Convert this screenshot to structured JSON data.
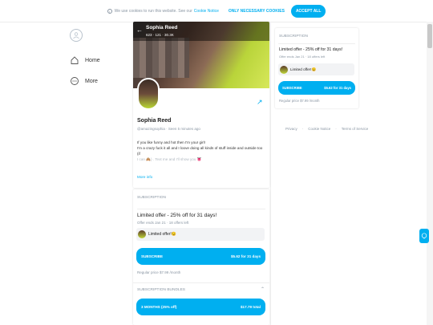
{
  "cookie": {
    "text": "We use cookies to run this website. See our",
    "link": "Cookie Notice",
    "necessary_label": "ONLY NECESSARY COOKIES",
    "accept_label": "ACCEPT ALL"
  },
  "sidebar": {
    "items": [
      {
        "label": "Home",
        "icon": "home-icon"
      },
      {
        "label": "More",
        "icon": "more-icon"
      }
    ]
  },
  "profile": {
    "cover_name": "Sophia Reed",
    "stats": "623 · 121 · 30.3K",
    "name": "Sophia Reed",
    "handle": "@amazingsophia · Seen 5 minutes ago",
    "bio_line1": "If you like funny and hot then I'm your girl!",
    "bio_line2": "I'm a crazy fuck it all and I loove doing all kinds of stuff inside and outside too (if",
    "bio_line3": "I can 🙈) . Text me and I'll show you 👅",
    "more_info": "More info"
  },
  "subscription": {
    "label": "SUBSCRIPTION",
    "offer_title": "Limited offer - 25% off for 31 days!",
    "offer_sub": "Offer ends Jan 21 · 18 offers left",
    "message": "Limited offer!😉",
    "subscribe_label": "SUBSCRIBE",
    "price_label": "$5.62 for 31 days",
    "regular_price": "Regular price $7.99 /month",
    "bundles_label": "SUBSCRIPTION BUNDLES",
    "bundle_label": "3 MONTHS (25% off)",
    "bundle_price": "$17.79 total"
  },
  "right": {
    "label": "SUBSCRIPTION",
    "offer_title": "Limited offer - 25% off for 31 days!",
    "offer_sub": "Offer ends Jan 21 · 18 offers left",
    "message": "Limited offer!😉",
    "subscribe_label": "SUBSCRIBE",
    "price_label": "$5.62 for 31 days",
    "regular_price": "Regular price $7.99 /month"
  },
  "footer": {
    "privacy": "Privacy",
    "cookie_notice": "Cookie Notice",
    "terms": "Terms of Service"
  },
  "colors": {
    "accent": "#00aff0",
    "muted": "#8a96a3"
  }
}
